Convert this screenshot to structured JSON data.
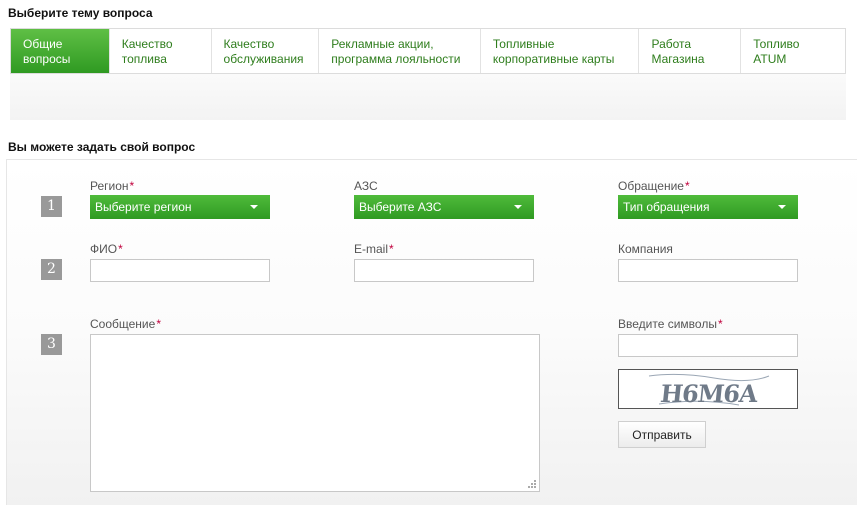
{
  "sections": {
    "topic_title": "Выберите тему вопроса",
    "ask_title": "Вы можете задать свой вопрос"
  },
  "tabs": [
    {
      "line1": "Общие",
      "line2": "вопросы",
      "active": true
    },
    {
      "line1": "Качество",
      "line2": "топлива",
      "active": false
    },
    {
      "line1": "Качество",
      "line2": "обслуживания",
      "active": false
    },
    {
      "line1": "Рекламные акции,",
      "line2": "программа лояльности",
      "active": false
    },
    {
      "line1": "Топливные",
      "line2": "корпоративные карты",
      "active": false
    },
    {
      "line1": "Работа",
      "line2": "Магазина",
      "active": false
    },
    {
      "line1": "Топливо",
      "line2": "ATUM",
      "active": false
    }
  ],
  "steps": [
    "1",
    "2",
    "3"
  ],
  "form": {
    "region": {
      "label": "Регион",
      "required_mark": "*",
      "selected": "Выберите регион"
    },
    "station": {
      "label": "АЗС",
      "selected": "Выберите АЗС"
    },
    "request": {
      "label": "Обращение",
      "required_mark": "*",
      "selected": "Тип обращения"
    },
    "fio": {
      "label": "ФИО",
      "required_mark": "*",
      "value": ""
    },
    "email": {
      "label": "E-mail",
      "required_mark": "*",
      "value": ""
    },
    "company": {
      "label": "Компания",
      "value": ""
    },
    "message": {
      "label": "Сообщение",
      "required_mark": "*",
      "value": ""
    },
    "captcha": {
      "label": "Введите символы",
      "required_mark": "*",
      "value": "",
      "image_text": "H6M6A"
    },
    "submit_label": "Отправить"
  },
  "colors": {
    "accent_green": "#3aa62b",
    "tab_text": "#2e7d1c",
    "required": "#c0003c",
    "step_bg": "#999999"
  }
}
